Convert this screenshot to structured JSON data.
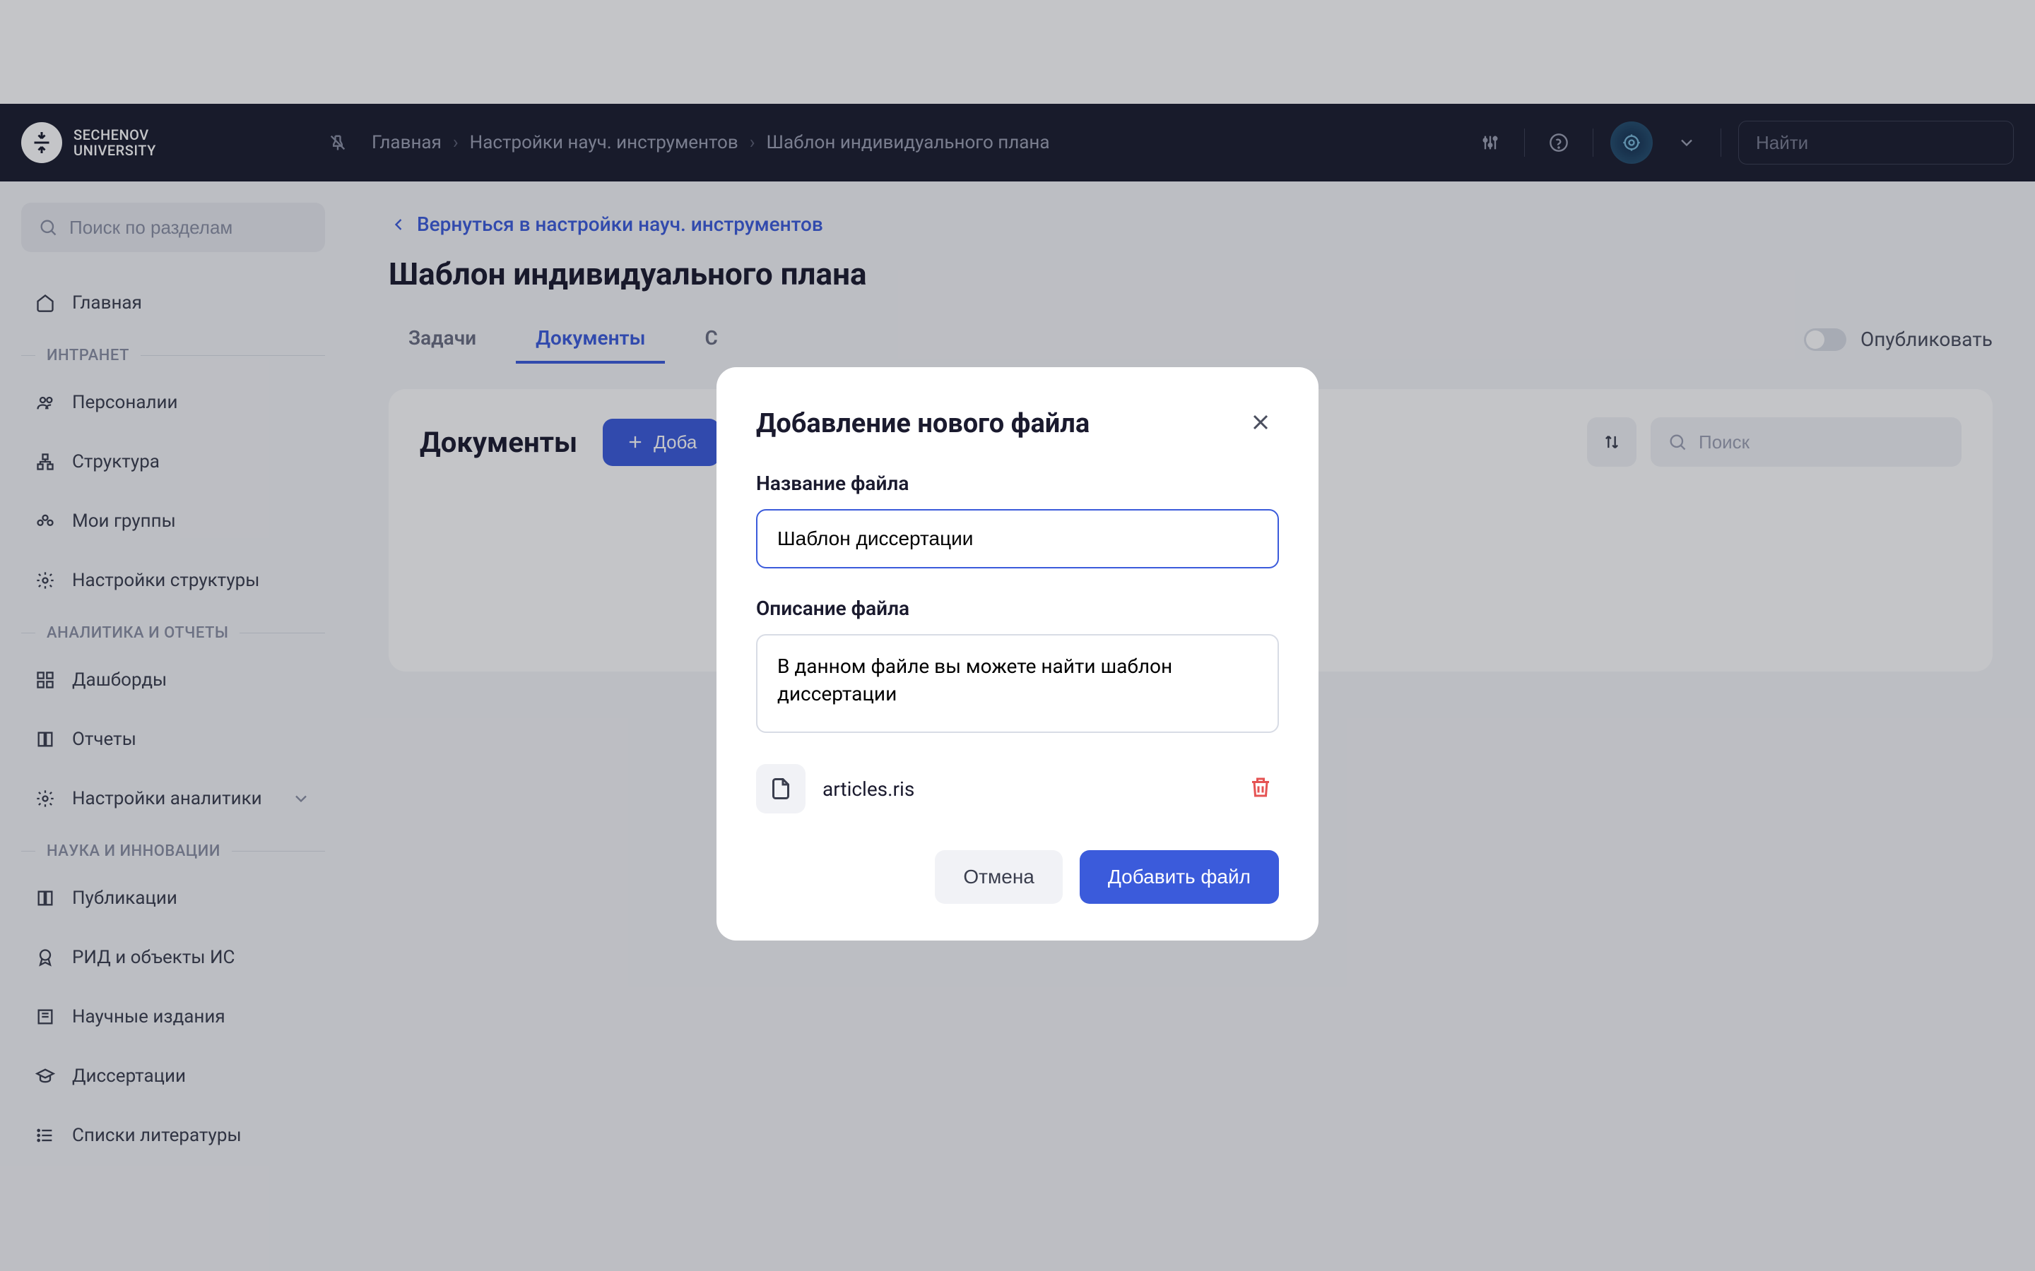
{
  "header": {
    "logo_text": "SECHENOV\nUNIVERSITY",
    "breadcrumb": [
      "Главная",
      "Настройки науч. инструментов",
      "Шаблон индивидуального плана"
    ],
    "search_placeholder": "Найти"
  },
  "sidebar": {
    "search_placeholder": "Поиск по разделам",
    "home": "Главная",
    "sections": [
      {
        "title": "ИНТРАНЕТ",
        "items": [
          "Персоналии",
          "Структура",
          "Мои группы",
          "Настройки структуры"
        ]
      },
      {
        "title": "АНАЛИТИКА И ОТЧЕТЫ",
        "items": [
          "Дашборды",
          "Отчеты",
          "Настройки аналитики"
        ]
      },
      {
        "title": "НАУКА И ИННОВАЦИИ",
        "items": [
          "Публикации",
          "РИД и объекты ИС",
          "Научные издания",
          "Диссертации",
          "Списки литературы"
        ]
      }
    ]
  },
  "main": {
    "back_link": "Вернуться в настройки науч. инструментов",
    "page_title": "Шаблон индивидуального плана",
    "tabs": [
      "Задачи",
      "Документы",
      "С"
    ],
    "active_tab": 1,
    "publish_label": "Опубликовать",
    "card": {
      "title": "Документы",
      "add_button": "Доба",
      "search_placeholder": "Поиск"
    }
  },
  "modal": {
    "title": "Добавление нового файла",
    "name_label": "Название файла",
    "name_value": "Шаблон диссертации",
    "desc_label": "Описание файла",
    "desc_value": "В данном файле вы можете найти шаблон диссертации",
    "file_name": "articles.ris",
    "cancel": "Отмена",
    "submit": "Добавить файл"
  }
}
